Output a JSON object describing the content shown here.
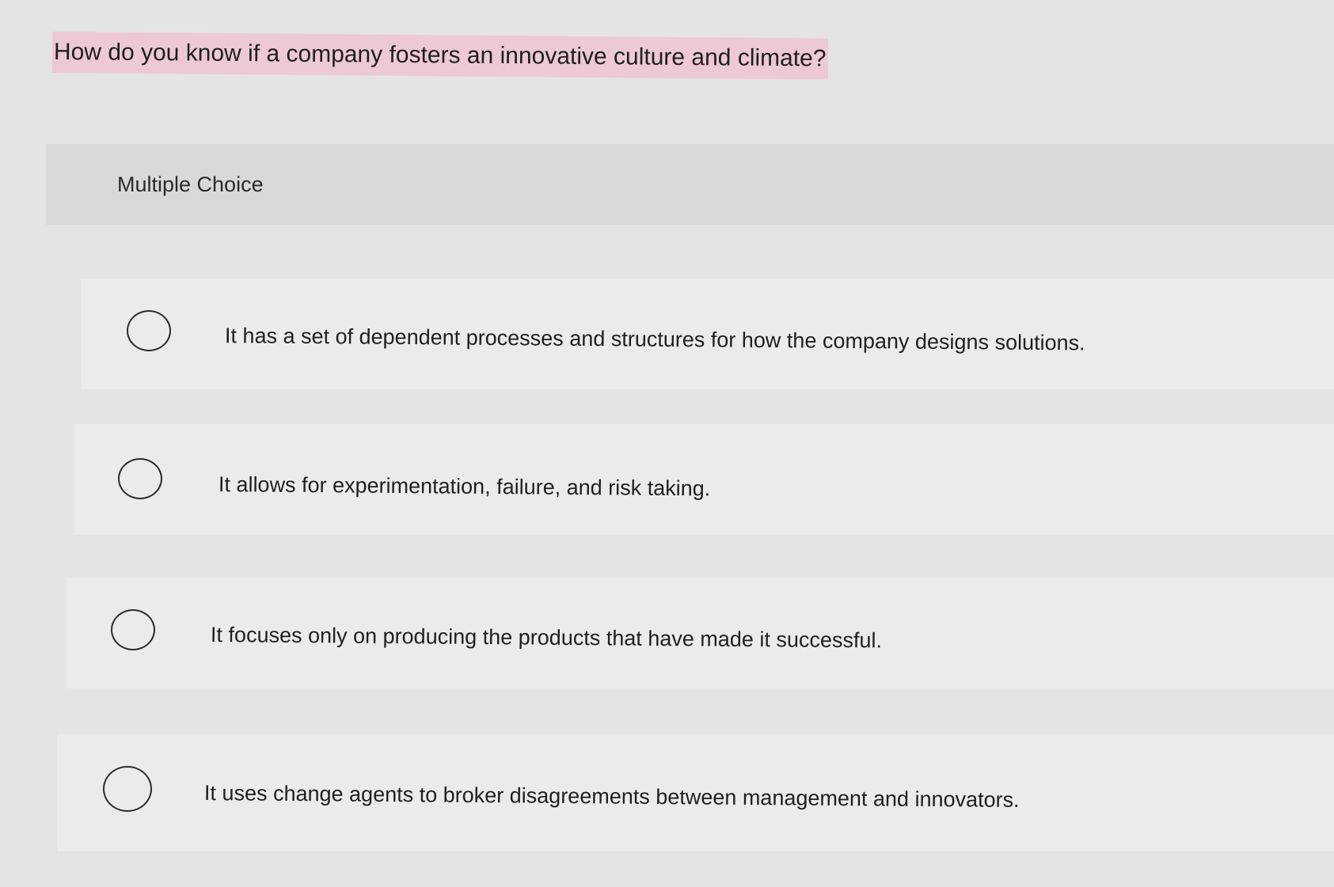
{
  "question": {
    "text": "How do you know if a company fosters an innovative culture and climate?",
    "highlight_color": "#edc9d3"
  },
  "choice_header": {
    "label": "Multiple Choice"
  },
  "options": [
    {
      "label": "It has a set of dependent processes and structures for how the company designs solutions.",
      "selected": false
    },
    {
      "label": "It allows for experimentation, failure, and risk taking.",
      "selected": false
    },
    {
      "label": "It focuses only on producing the products that have made it successful.",
      "selected": false
    },
    {
      "label": "It uses change agents to broker disagreements between management and innovators.",
      "selected": false
    }
  ],
  "icons": {
    "radio": "radio-unchecked-icon"
  }
}
